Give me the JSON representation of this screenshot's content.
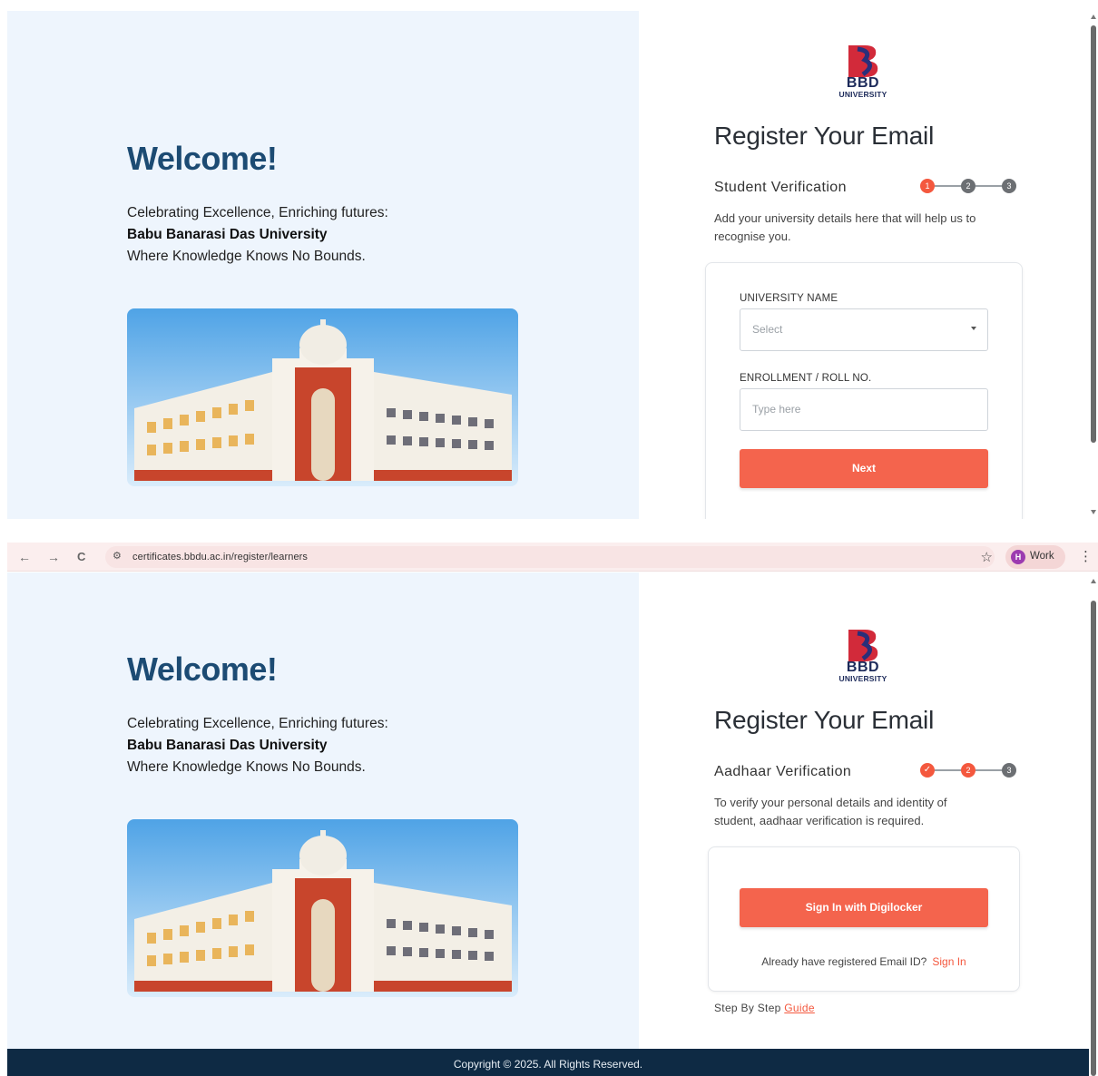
{
  "top_screen": {
    "welcome": "Welcome!",
    "tagline_line1": "Celebrating Excellence, Enriching futures:",
    "tagline_line2": "Babu Banarasi Das University",
    "tagline_line3": "Where Knowledge Knows No Bounds.",
    "logo_text": "BBD",
    "logo_subtext": "UNIVERSITY",
    "register_title": "Register Your Email",
    "step_title": "Student Verification",
    "steps": [
      "1",
      "2",
      "3"
    ],
    "step_description": "Add your university details here that will help us to recognise you.",
    "university_label": "UNIVERSITY NAME",
    "university_placeholder": "Select",
    "enrollment_label": "ENROLLMENT / ROLL NO.",
    "enrollment_placeholder": "Type here",
    "next_button": "Next"
  },
  "browser": {
    "back_icon": "←",
    "forward_icon": "→",
    "reload_icon": "C",
    "site_settings_icon": "⚙",
    "url": "certificates.bbdu.ac.in/register/learners",
    "bookmark_icon": "☆",
    "profile_initial": "H",
    "profile_name": "Work",
    "menu_icon": "⋮"
  },
  "bottom_screen": {
    "welcome": "Welcome!",
    "tagline_line1": "Celebrating Excellence, Enriching futures:",
    "tagline_line2": "Babu Banarasi Das University",
    "tagline_line3": "Where Knowledge Knows No Bounds.",
    "logo_text": "BBD",
    "logo_subtext": "UNIVERSITY",
    "register_title": "Register Your Email",
    "step_title": "Aadhaar Verification",
    "steps": [
      "✓",
      "2",
      "3"
    ],
    "step_description": "To verify your personal details and identity of student, aadhaar verification is required.",
    "digilocker_button": "Sign In with Digilocker",
    "already_registered": "Already have registered Email ID?",
    "sign_in_link": "Sign In",
    "guide_prefix": "Step By Step",
    "guide_link": "Guide",
    "footer": "Copyright © 2025. All Rights Reserved."
  },
  "colors": {
    "accent": "#f4583e",
    "welcome_text": "#1c4b73",
    "left_bg": "#eef5fd",
    "footer_bg": "#0e2a44"
  }
}
